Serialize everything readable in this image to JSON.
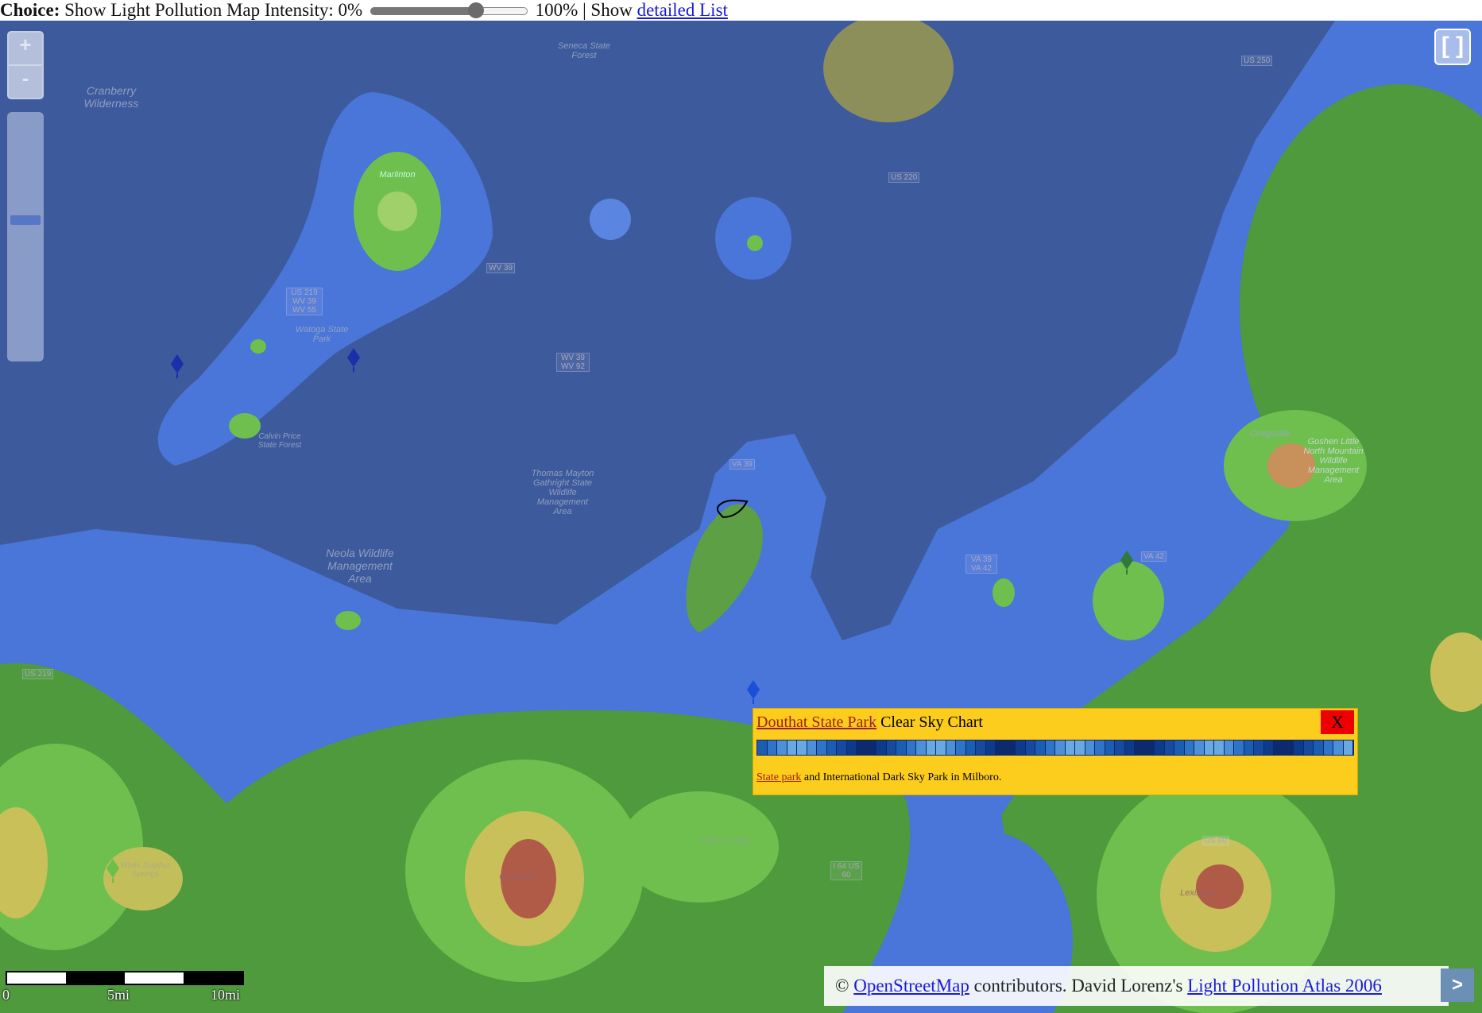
{
  "controls": {
    "choice_label": "Choice:",
    "show_text": "Show Light Pollution Map Intensity: 0%",
    "intensity_percent": 67,
    "max_text": "100% | Show",
    "list_link": "detailed List"
  },
  "map": {
    "zoom_in": "+",
    "zoom_out": "-",
    "zoom_level_fraction": 0.43,
    "fullscreen": "[ ]",
    "place_labels": {
      "cranberry": "Cranberry Wilderness",
      "seneca": "Seneca State Forest",
      "marlinton": "Marlinton",
      "watoga": "Watoga State Park",
      "calvin": "Calvin Price State Forest",
      "neola": "Neola Wildlife Management Area",
      "thomas": "Thomas Mayton Gathright State Wildlife Management Area",
      "craigsville": "Craigsville",
      "goshen": "Goshen Little North Mountain Wildlife Management Area",
      "covington": "Covington",
      "clifton": "Clifton Forge",
      "lexington": "Lexington",
      "white_sulphur": "White Sulphur Springs"
    },
    "road_labels": {
      "us250": "US 250",
      "us220": "US 220",
      "wv39a": "WV 39",
      "us219": "US 219 WV 39 WV 55",
      "wv39b": "WV 39 WV 92",
      "va39": "VA 39",
      "va39b": "VA 39 VA 42",
      "va42": "VA 42",
      "us219b": "US 219",
      "us60": "US 60",
      "i64": "I 64 US 60"
    },
    "colors": {
      "dark": "#3c5a9c",
      "blue": "#4a75d9",
      "light_green": "#6fbf4e",
      "green": "#4e9a3c",
      "yellow": "#c9c05a",
      "orange": "#c8905a",
      "red": "#b05a48"
    }
  },
  "popup": {
    "link_text": "Douthat State Park",
    "title_suffix": "Clear Sky Chart",
    "close_label": "X",
    "desc_link": "State park",
    "desc_text": "and International Dark Sky Park in Milboro.",
    "strip_colors": [
      "#0d2a6e",
      "#0d3a8a",
      "#174a9e",
      "#1c5db4",
      "#2f74c8",
      "#4e90d8",
      "#6aa8e2"
    ]
  },
  "scale": {
    "labels": [
      "0",
      "5mi",
      "10mi"
    ]
  },
  "attribution": {
    "prefix": "©",
    "osm_link": "OpenStreetMap",
    "middle": "contributors. David Lorenz's",
    "atlas_link": "Light Pollution Atlas 2006",
    "toggle": ">"
  }
}
